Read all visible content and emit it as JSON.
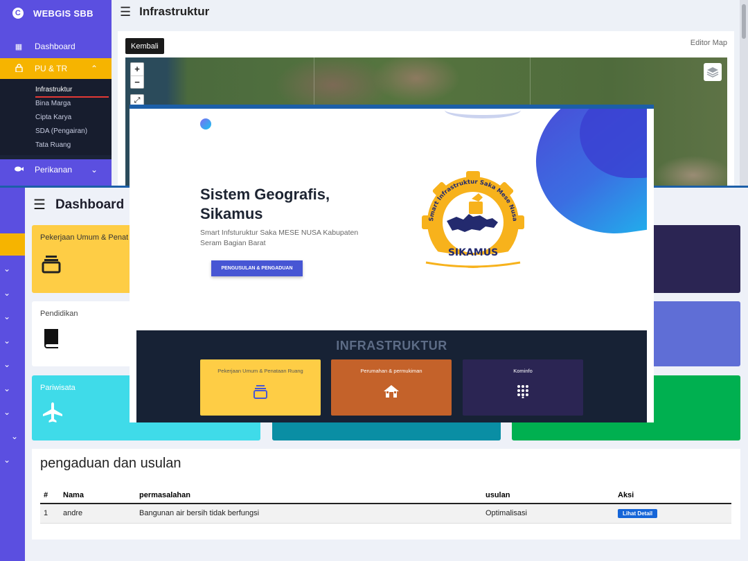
{
  "back_window": {
    "brand": "WEBGIS SBB",
    "brand_icon": "c-logo-icon",
    "menu": {
      "dashboard": "Dashboard",
      "pu_tr": "PU & TR",
      "perikanan": "Perikanan"
    },
    "submenu": [
      "Infrastruktur",
      "Bina Marga",
      "Cipta Karya",
      "SDA (Pengairan)",
      "Tata Ruang"
    ],
    "page_title": "Infrastruktur",
    "kembali_label": "Kembali",
    "editor_link": "Editor Map",
    "zoom_in": "+",
    "zoom_out": "−"
  },
  "dashboard_window": {
    "title": "Dashboard",
    "cards": {
      "pu": "Pekerjaan Umum & Penat",
      "pendidikan": "Pendidikan",
      "pariwisata": "Pariwisata"
    },
    "colors": {
      "yellow": "#fecd45",
      "cyan": "#3fdbe9",
      "teal": "#0a8ea4",
      "green": "#00b050",
      "navy": "#2b2553",
      "periwinkle": "#5f6ed6"
    },
    "table": {
      "title": "pengaduan dan usulan",
      "headers": {
        "no": "#",
        "nama": "Nama",
        "permasalahan": "permasalahan",
        "usulan": "usulan",
        "aksi": "Aksi"
      },
      "rows": [
        {
          "no": "1",
          "nama": "andre",
          "permasalahan": "Bangunan air bersih tidak berfungsi",
          "usulan": "Optimalisasi",
          "aksi": "Lihat Detail"
        }
      ]
    }
  },
  "landing_window": {
    "title_line1": "Sistem Geografis,",
    "title_line2": "Sikamus",
    "subtitle": "Smart Infsturuktur Saka MESE NUSA Kabupaten Seram Bagian Barat",
    "cta": "PENGUSULAN & PENGADUAN",
    "logo_arc_text": "Smart Infrastruktur Saka Mese Nusa",
    "logo_name": "SIKAMUS",
    "section_title": "INFRASTRUKTUR",
    "cards": [
      {
        "label": "Pekerjaan Umum & Penataan Ruang",
        "icon": "layers-stack-icon"
      },
      {
        "label": "Perumahan & permukiman",
        "icon": "house-icon"
      },
      {
        "label": "Kominfo",
        "icon": "dots-grid-icon"
      }
    ],
    "card_colors": [
      "#fecd45",
      "#c4622a",
      "#2b2553"
    ]
  }
}
